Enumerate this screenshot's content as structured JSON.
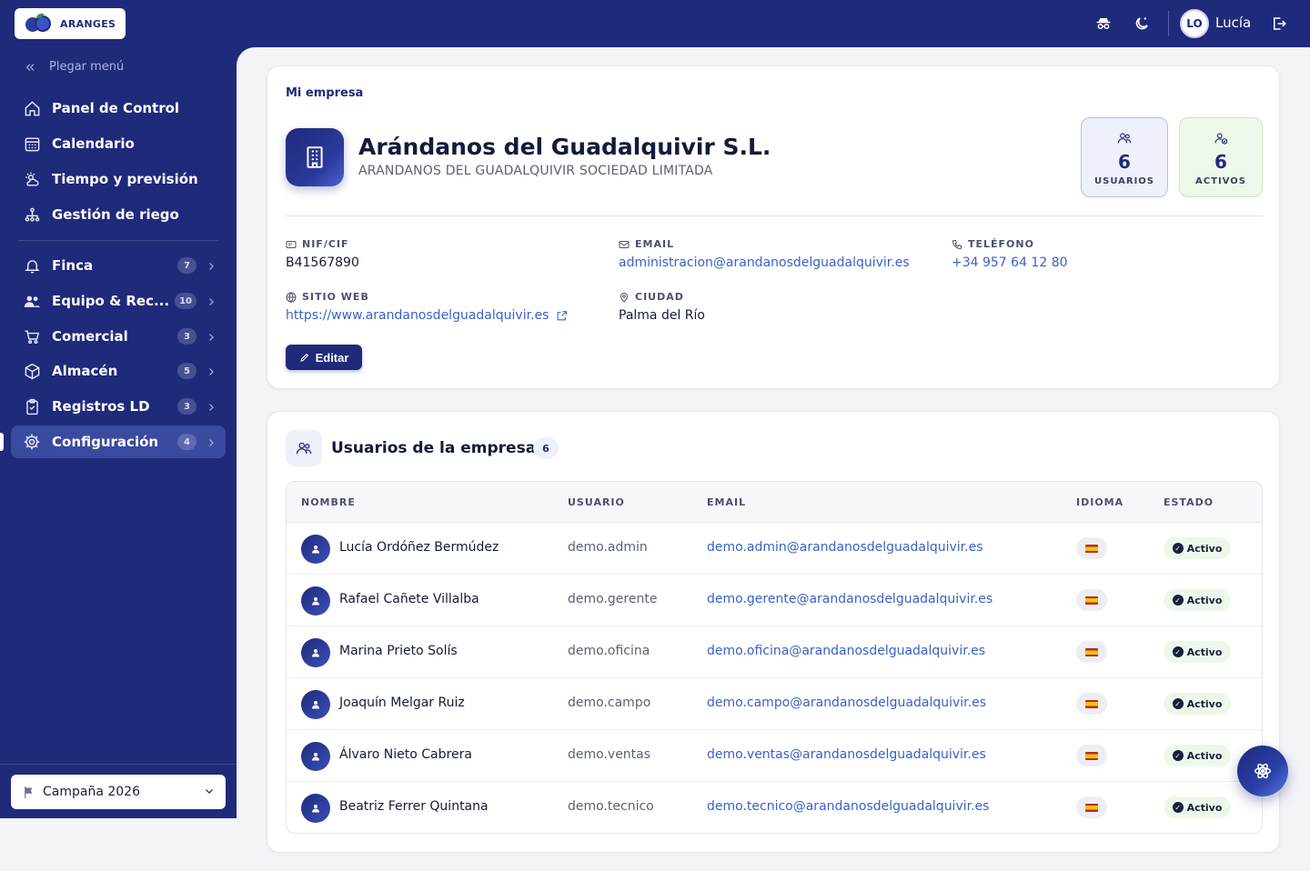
{
  "topbar": {
    "logo_text": "ARANGES",
    "user_initials": "LO",
    "user_name": "Lucía",
    "icons": [
      "incognito-icon",
      "moon-icon",
      "logout-icon"
    ]
  },
  "sidebar": {
    "collapse_label": "Plegar menú",
    "primary": [
      {
        "label": "Panel de Control",
        "icon": "home-icon"
      },
      {
        "label": "Calendario",
        "icon": "calendar-icon"
      },
      {
        "label": "Tiempo y previsión",
        "icon": "weather-icon"
      },
      {
        "label": "Gestión de riego",
        "icon": "irrigation-icon"
      }
    ],
    "modules": [
      {
        "label": "Finca",
        "badge": "7",
        "icon": "bell-icon"
      },
      {
        "label": "Equipo & Rec...",
        "badge": "10",
        "icon": "team-icon"
      },
      {
        "label": "Comercial",
        "badge": "3",
        "icon": "cart-icon"
      },
      {
        "label": "Almacén",
        "badge": "5",
        "icon": "box-icon"
      },
      {
        "label": "Registros LD",
        "badge": "3",
        "icon": "clipboard-icon"
      },
      {
        "label": "Configuración",
        "badge": "4",
        "icon": "gear-icon",
        "active": true
      }
    ],
    "campaign": "Campaña 2026"
  },
  "company": {
    "section_title": "Mi empresa",
    "name": "Arándanos del Guadalquivir S.L.",
    "legal_name": "ARANDANOS DEL GUADALQUIVIR SOCIEDAD LIMITADA",
    "stats": {
      "users_value": "6",
      "users_label": "USUARIOS",
      "active_value": "6",
      "active_label": "ACTIVOS"
    },
    "fields": {
      "nif_label": "NIF/CIF",
      "nif_value": "B41567890",
      "email_label": "EMAIL",
      "email_value": "administracion@arandanosdelguadalquivir.es",
      "phone_label": "TELÉFONO",
      "phone_value": "+34 957 64 12 80",
      "web_label": "SITIO WEB",
      "web_value": "https://www.arandanosdelguadalquivir.es",
      "city_label": "CIUDAD",
      "city_value": "Palma del Río"
    },
    "edit_label": "Editar"
  },
  "users": {
    "title": "Usuarios de la empresa",
    "count": "6",
    "columns": {
      "name": "NOMBRE",
      "user": "USUARIO",
      "email": "EMAIL",
      "language": "IDIOMA",
      "status": "ESTADO"
    },
    "rows": [
      {
        "name": "Lucía Ordóñez Bermúdez",
        "user": "demo.admin",
        "email": "demo.admin@arandanosdelguadalquivir.es",
        "status": "Activo"
      },
      {
        "name": "Rafael Cañete Villalba",
        "user": "demo.gerente",
        "email": "demo.gerente@arandanosdelguadalquivir.es",
        "status": "Activo"
      },
      {
        "name": "Marina Prieto Solís",
        "user": "demo.oficina",
        "email": "demo.oficina@arandanosdelguadalquivir.es",
        "status": "Activo"
      },
      {
        "name": "Joaquín Melgar Ruiz",
        "user": "demo.campo",
        "email": "demo.campo@arandanosdelguadalquivir.es",
        "status": "Activo"
      },
      {
        "name": "Álvaro Nieto Cabrera",
        "user": "demo.ventas",
        "email": "demo.ventas@arandanosdelguadalquivir.es",
        "status": "Activo"
      },
      {
        "name": "Beatriz Ferrer Quintana",
        "user": "demo.tecnico",
        "email": "demo.tecnico@arandanosdelguadalquivir.es",
        "status": "Activo"
      }
    ]
  },
  "colors": {
    "brand": "#1f2a7a",
    "link": "#3a62c4",
    "active_badge_bg": "#eef8ea"
  }
}
